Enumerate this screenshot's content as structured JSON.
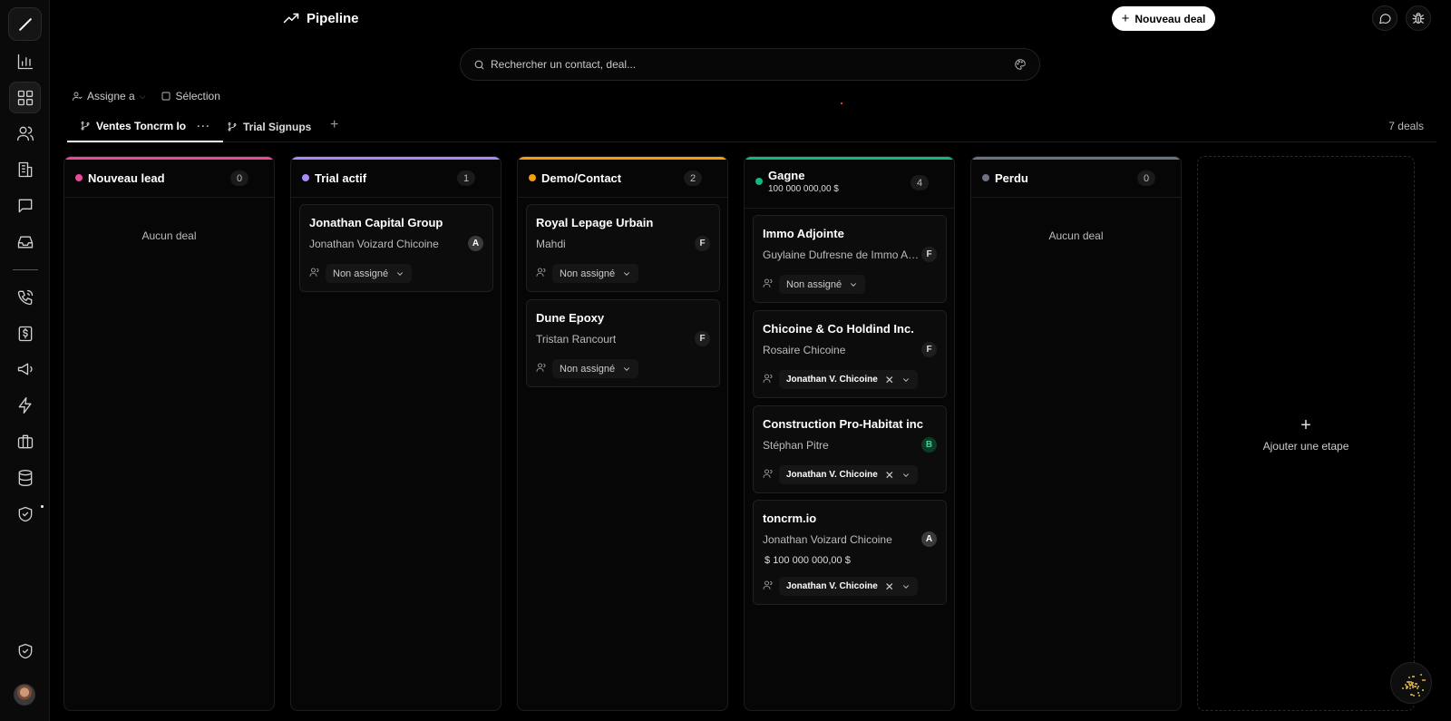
{
  "header": {
    "title": "Pipeline",
    "new_deal_label": "Nouveau deal"
  },
  "search": {
    "placeholder": "Rechercher un contact, deal..."
  },
  "filters": {
    "assign_label": "Assigne a",
    "selection_label": "Sélection"
  },
  "tabs": [
    {
      "label": "Ventes Toncrm Io",
      "active": true
    },
    {
      "label": "Trial Signups",
      "active": false
    }
  ],
  "deal_count": "7 deals",
  "columns": [
    {
      "name": "Nouveau lead",
      "count": "0",
      "color": "#ec4899",
      "empty_label": "Aucun deal"
    },
    {
      "name": "Trial actif",
      "count": "1",
      "color": "#a78bfa"
    },
    {
      "name": "Demo/Contact",
      "count": "2",
      "color": "#f59e0b"
    },
    {
      "name": "Gagne",
      "count": "4",
      "color": "#10b981",
      "total": "100 000 000,00 $"
    },
    {
      "name": "Perdu",
      "count": "0",
      "color": "#6b7280",
      "empty_label": "Aucun deal"
    }
  ],
  "cards": {
    "trial": [
      {
        "title": "Jonathan Capital Group",
        "contact": "Jonathan Voizard Chicoine",
        "badge": "A",
        "assignee": "Non assigné"
      }
    ],
    "demo": [
      {
        "title": "Royal Lepage Urbain",
        "contact": "Mahdi",
        "badge": "F",
        "assignee": "Non assigné"
      },
      {
        "title": "Dune Epoxy",
        "contact": "Tristan Rancourt",
        "badge": "F",
        "assignee": "Non assigné"
      }
    ],
    "won": [
      {
        "title": "Immo Adjointe",
        "contact": "Guylaine Dufresne de Immo Adj...",
        "badge": "F",
        "assignee": "Non assigné"
      },
      {
        "title": "Chicoine & Co Holdind Inc.",
        "contact": "Rosaire Chicoine",
        "badge": "F",
        "assignee": "Jonathan V. Chicoine"
      },
      {
        "title": "Construction Pro-Habitat inc",
        "contact": "Stéphan Pitre",
        "badge": "B",
        "assignee": "Jonathan V. Chicoine"
      },
      {
        "title": "toncrm.io",
        "contact": "Jonathan Voizard Chicoine",
        "badge": "A",
        "amount": "100 000 000,00 $",
        "assignee": "Jonathan V. Chicoine"
      }
    ]
  },
  "add_stage_label": "Ajouter une etape",
  "colors": {
    "background": "#000000",
    "card": "#0c0c0c",
    "accent_won": "#10b981"
  }
}
